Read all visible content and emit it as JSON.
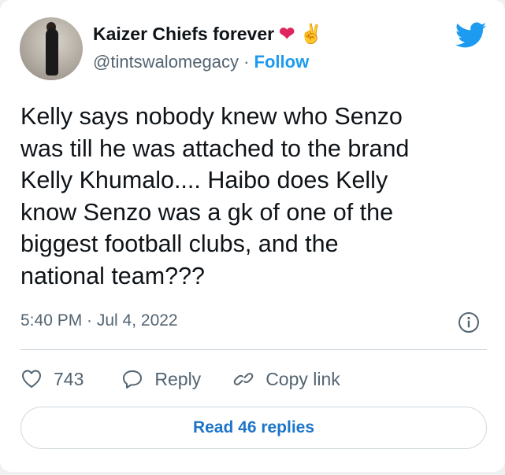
{
  "tweet": {
    "author_name": "Kaizer Chiefs forever",
    "author_emojis": [
      "❤",
      "✌"
    ],
    "handle": "@tintswalomegacy",
    "separator": "·",
    "follow_label": "Follow",
    "text": "Kelly says nobody knew who Senzo\nwas till he was attached to the brand\nKelly Khumalo.... Haibo does Kelly\nknow Senzo was a gk of one of the\nbiggest football clubs, and the\nnational team???",
    "timestamp": "5:40 PM · Jul 4, 2022",
    "like_count": "743",
    "reply_label": "Reply",
    "copy_link_label": "Copy link",
    "read_replies_label": "Read 46 replies"
  },
  "icons": {
    "brand": "twitter-bird-icon",
    "info": "info-icon",
    "like": "heart-icon",
    "reply": "speech-bubble-icon",
    "copy": "link-icon"
  },
  "colors": {
    "accent": "#1d9bf0",
    "text": "#0f1419",
    "muted": "#536471",
    "heart_emoji": "#e0245e"
  }
}
